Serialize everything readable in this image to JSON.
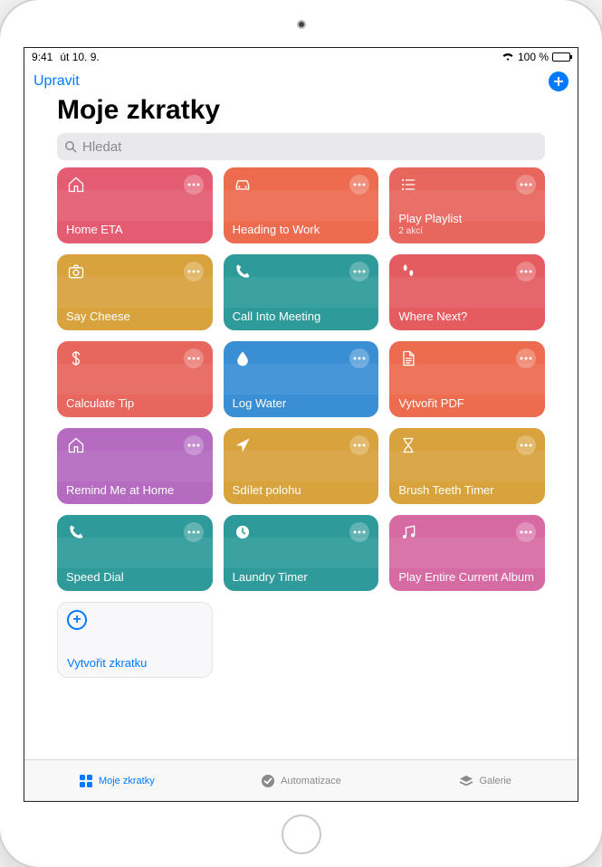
{
  "status": {
    "time": "9:41",
    "date": "út 10. 9.",
    "battery_pct": "100 %"
  },
  "navbar": {
    "edit": "Upravit"
  },
  "title": "Moje zkratky",
  "search": {
    "placeholder": "Hledat"
  },
  "cards": [
    {
      "name": "Home ETA",
      "icon": "home",
      "color": "#e45c72",
      "sub": ""
    },
    {
      "name": "Heading to Work",
      "icon": "car",
      "color": "#ed6b4f",
      "sub": ""
    },
    {
      "name": "Play Playlist",
      "icon": "list",
      "color": "#e7665e",
      "sub": "2 akcí"
    },
    {
      "name": "Say Cheese",
      "icon": "camera",
      "color": "#d8a23d",
      "sub": ""
    },
    {
      "name": "Call Into Meeting",
      "icon": "phone",
      "color": "#2e9a9a",
      "sub": ""
    },
    {
      "name": "Where Next?",
      "icon": "steps",
      "color": "#e45c60",
      "sub": ""
    },
    {
      "name": "Calculate Tip",
      "icon": "dollar",
      "color": "#e7665e",
      "sub": ""
    },
    {
      "name": "Log Water",
      "icon": "drop",
      "color": "#3a8fd4",
      "sub": ""
    },
    {
      "name": "Vytvořit PDF",
      "icon": "doc",
      "color": "#ed6b4f",
      "sub": ""
    },
    {
      "name": "Remind Me at Home",
      "icon": "home",
      "color": "#b46bc0",
      "sub": ""
    },
    {
      "name": "Sdílet polohu",
      "icon": "location",
      "color": "#d8a23d",
      "sub": ""
    },
    {
      "name": "Brush Teeth Timer",
      "icon": "hourglass",
      "color": "#d8a23d",
      "sub": ""
    },
    {
      "name": "Speed Dial",
      "icon": "phone",
      "color": "#2e9a9a",
      "sub": ""
    },
    {
      "name": "Laundry Timer",
      "icon": "clock",
      "color": "#2e9a9a",
      "sub": ""
    },
    {
      "name": "Play Entire Current Album",
      "icon": "music",
      "color": "#d66ba3",
      "sub": ""
    }
  ],
  "create": {
    "label": "Vytvořit zkratku"
  },
  "tabs": [
    {
      "label": "Moje zkratky",
      "active": true,
      "icon": "grid"
    },
    {
      "label": "Automatizace",
      "active": false,
      "icon": "check"
    },
    {
      "label": "Galerie",
      "active": false,
      "icon": "stack"
    }
  ]
}
